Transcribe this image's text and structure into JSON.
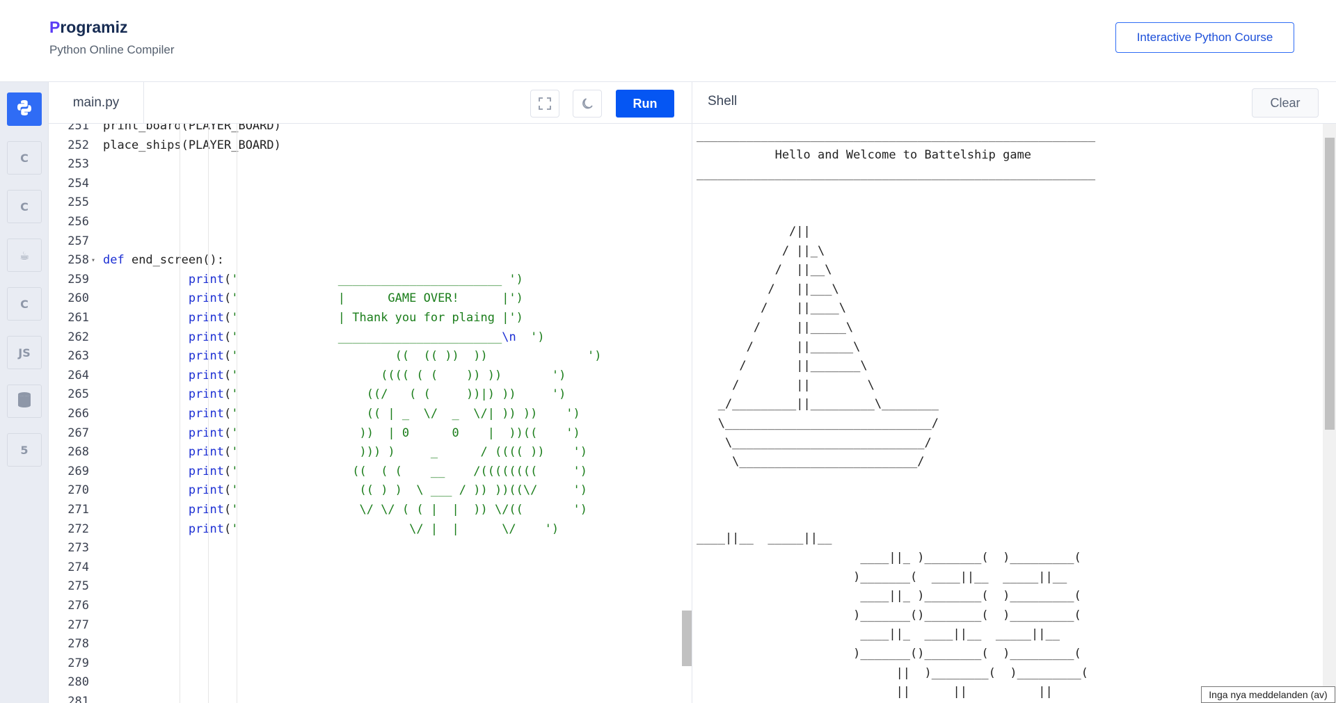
{
  "header": {
    "logo_text": "rogramiz",
    "logo_initial": "P",
    "subtitle": "Python Online Compiler",
    "course_button": "Interactive Python Course"
  },
  "languages": [
    {
      "name": "python-lang-icon",
      "label": "",
      "active": true
    },
    {
      "name": "c-lang-icon",
      "label": "C",
      "active": false
    },
    {
      "name": "cpp-lang-icon",
      "label": "C",
      "active": false
    },
    {
      "name": "java-lang-icon",
      "label": "☕",
      "active": false
    },
    {
      "name": "csharp-lang-icon",
      "label": "C",
      "active": false
    },
    {
      "name": "js-lang-icon",
      "label": "JS",
      "active": false
    },
    {
      "name": "sql-lang-icon",
      "label": "",
      "active": false
    },
    {
      "name": "html-lang-icon",
      "label": "5",
      "active": false
    }
  ],
  "editor": {
    "tab_label": "main.py",
    "run_label": "Run",
    "lines": [
      {
        "n": "251",
        "t": [
          [
            "",
            "print_board(PLAYER_BOARD)"
          ]
        ]
      },
      {
        "n": "252",
        "t": [
          [
            "",
            "place_ships(PLAYER_BOARD)"
          ]
        ]
      },
      {
        "n": "253",
        "t": []
      },
      {
        "n": "254",
        "t": []
      },
      {
        "n": "255",
        "t": []
      },
      {
        "n": "256",
        "t": []
      },
      {
        "n": "257",
        "t": []
      },
      {
        "n": "258",
        "t": [
          [
            "kw",
            "def"
          ],
          [
            "",
            " end_screen():"
          ]
        ]
      },
      {
        "n": "259",
        "t": [
          [
            "",
            "            "
          ],
          [
            "fn",
            "print"
          ],
          [
            "",
            "("
          ],
          [
            "st",
            "'              _______________________ ')"
          ]
        ]
      },
      {
        "n": "260",
        "t": [
          [
            "",
            "            "
          ],
          [
            "fn",
            "print"
          ],
          [
            "",
            "("
          ],
          [
            "st",
            "'              |      GAME OVER!      |')"
          ]
        ]
      },
      {
        "n": "261",
        "t": [
          [
            "",
            "            "
          ],
          [
            "fn",
            "print"
          ],
          [
            "",
            "("
          ],
          [
            "st",
            "'              | Thank you for plaing |')"
          ]
        ]
      },
      {
        "n": "262",
        "t": [
          [
            "",
            "            "
          ],
          [
            "fn",
            "print"
          ],
          [
            "",
            "("
          ],
          [
            "st",
            "'              _______________________"
          ],
          [
            "kw",
            "\\n"
          ],
          [
            "st",
            "  ')"
          ]
        ]
      },
      {
        "n": "263",
        "t": [
          [
            "",
            "            "
          ],
          [
            "fn",
            "print"
          ],
          [
            "",
            "("
          ],
          [
            "st",
            "'                      ((  (( ))  ))              ')"
          ]
        ]
      },
      {
        "n": "264",
        "t": [
          [
            "",
            "            "
          ],
          [
            "fn",
            "print"
          ],
          [
            "",
            "("
          ],
          [
            "st",
            "'                    (((( ( (    )) ))       ')"
          ]
        ]
      },
      {
        "n": "265",
        "t": [
          [
            "",
            "            "
          ],
          [
            "fn",
            "print"
          ],
          [
            "",
            "("
          ],
          [
            "st",
            "'                  ((/   ( (     ))|) ))     ')"
          ]
        ]
      },
      {
        "n": "266",
        "t": [
          [
            "",
            "            "
          ],
          [
            "fn",
            "print"
          ],
          [
            "",
            "("
          ],
          [
            "st",
            "'                  (( | _  \\/  _  \\/| )) ))    ')"
          ]
        ]
      },
      {
        "n": "267",
        "t": [
          [
            "",
            "            "
          ],
          [
            "fn",
            "print"
          ],
          [
            "",
            "("
          ],
          [
            "st",
            "'                 ))  | 0      0    |  ))((    ')"
          ]
        ]
      },
      {
        "n": "268",
        "t": [
          [
            "",
            "            "
          ],
          [
            "fn",
            "print"
          ],
          [
            "",
            "("
          ],
          [
            "st",
            "'                 ))) )     _      / (((( ))    ')"
          ]
        ]
      },
      {
        "n": "269",
        "t": [
          [
            "",
            "            "
          ],
          [
            "fn",
            "print"
          ],
          [
            "",
            "("
          ],
          [
            "st",
            "'                ((  ( (    __    /((((((((     ')"
          ]
        ]
      },
      {
        "n": "270",
        "t": [
          [
            "",
            "            "
          ],
          [
            "fn",
            "print"
          ],
          [
            "",
            "("
          ],
          [
            "st",
            "'                 (( ) )  \\ ___ / )) ))((\\/     ')"
          ]
        ]
      },
      {
        "n": "271",
        "t": [
          [
            "",
            "            "
          ],
          [
            "fn",
            "print"
          ],
          [
            "",
            "("
          ],
          [
            "st",
            "'                 \\/ \\/ ( ( |  |  )) \\/((       ')"
          ]
        ]
      },
      {
        "n": "272",
        "t": [
          [
            "",
            "            "
          ],
          [
            "fn",
            "print"
          ],
          [
            "",
            "("
          ],
          [
            "st",
            "'                        \\/ |  |      \\/    ')"
          ]
        ]
      },
      {
        "n": "273",
        "t": []
      },
      {
        "n": "274",
        "t": []
      },
      {
        "n": "275",
        "t": []
      },
      {
        "n": "276",
        "t": []
      },
      {
        "n": "277",
        "t": []
      },
      {
        "n": "278",
        "t": []
      },
      {
        "n": "279",
        "t": []
      },
      {
        "n": "280",
        "t": []
      },
      {
        "n": "281",
        "t": []
      }
    ]
  },
  "shell": {
    "title": "Shell",
    "clear_label": "Clear",
    "output": "________________________________________________________\n           Hello and Welcome to Battelship game\n________________________________________________________\n\n\n             /||\n            / ||_\\\n           /  ||__\\\n          /   ||___\\\n         /    ||____\\\n        /     ||_____\\\n       /      ||______\\\n      /       ||_______\\\n     /        ||        \\\n   _/_________||_________\\________\n   \\_____________________________/\n    \\___________________________/\n     \\_________________________/\n\n\n\n____||__  _____||__\n                       ____||_ )________(  )_________(\n                      )_______(  ____||__  _____||__\n                       ____||_ )________(  )_________(\n                      )_______()________(  )_________(\n                       ____||_  ____||__  _____||__\n                      )_______()________(  )_________(\n                            ||  )________(  )_________(\n                            ||      ||          ||"
  },
  "notification": "Inga nya meddelanden (av)"
}
